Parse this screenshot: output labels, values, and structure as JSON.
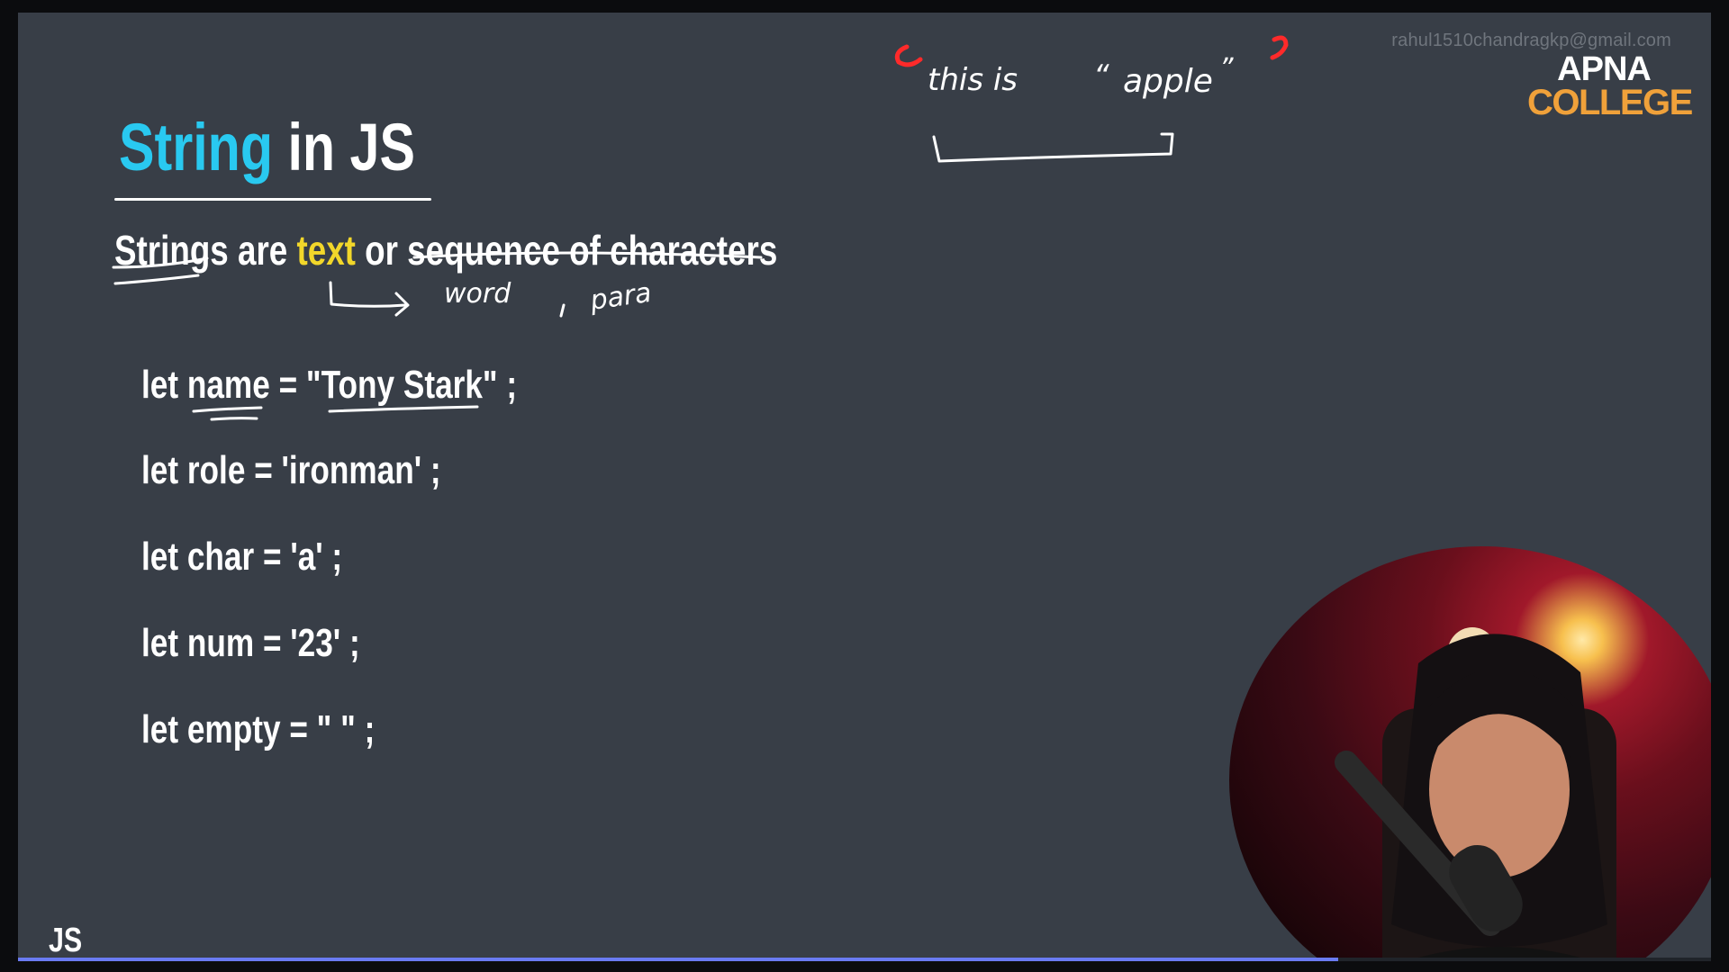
{
  "slide": {
    "title_accent": "String",
    "title_rest": "in JS",
    "subtitle": {
      "part1": "Strings are ",
      "highlight": "text",
      "part2": " or ",
      "part3": "sequence of characters"
    },
    "code_lines": [
      "let name = \"Tony Stark\" ;",
      "let role = 'ironman' ;",
      "let char = 'a' ;",
      "let num = '23' ;",
      "let empty = \" \" ;"
    ],
    "footer_label": "JS"
  },
  "annotations": {
    "word_note": "word",
    "para_note": "para",
    "sentence": "this is",
    "quoted_word": "apple"
  },
  "watermark": {
    "email": "rahul1510chandragkp@gmail.com",
    "logo_line1": "APNA",
    "logo_line2": "COLLEGE"
  },
  "video": {
    "progress_percent": 78
  },
  "colors": {
    "background": "#383e47",
    "title_accent": "#29c9f0",
    "highlight": "#f2d72a",
    "annotation_red": "#ff2a2a",
    "logo_orange": "#f0a13a",
    "progress": "#6a7bf2"
  }
}
